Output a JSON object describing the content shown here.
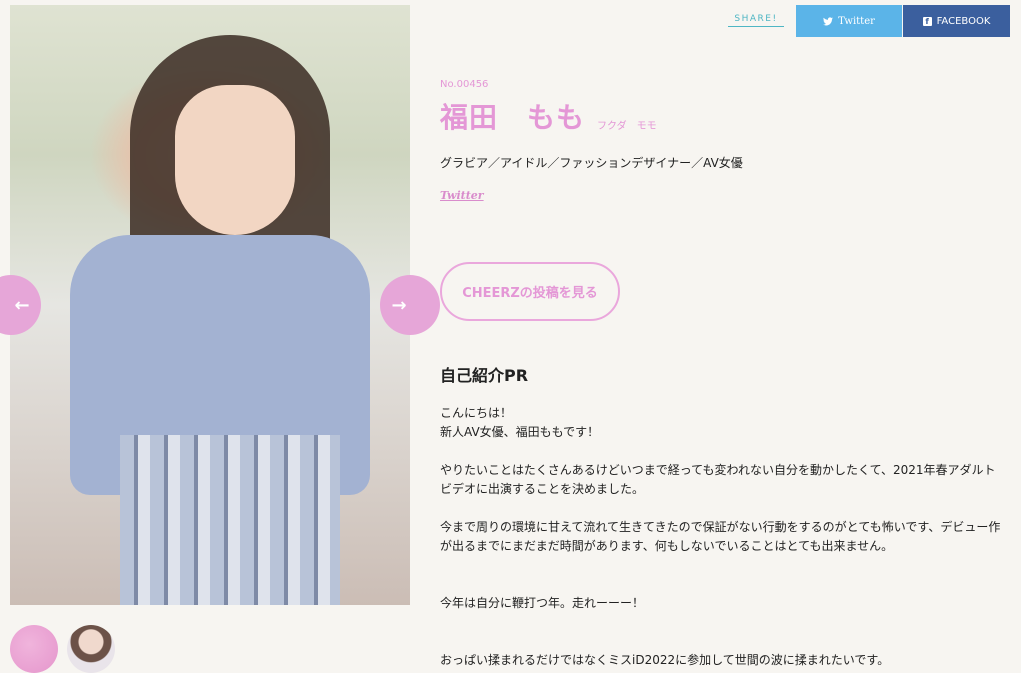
{
  "share": {
    "label": "SHARE!",
    "twitter_label": "Twitter",
    "facebook_label": "FACEBOOK",
    "twitter_color": "#5bb4e8",
    "facebook_color": "#3b5f9e"
  },
  "gallery": {
    "prev_icon": "arrow-left-icon",
    "next_icon": "arrow-right-icon",
    "arrow_color": "#e6a6d8",
    "thumbnail_count": 2
  },
  "profile": {
    "entry_no": "No.00456",
    "name": "福田　もも",
    "kana": "フクダ　モモ",
    "tags": "グラビア／アイドル／ファッションデザイナー／AV女優",
    "twitter_link": "Twitter",
    "accent_color": "#e497d6"
  },
  "cheerz_button": "CHEERZの投稿を見る",
  "pr": {
    "title": "自己紹介PR",
    "lines": [
      "こんにちは！",
      "新人AV女優、福田ももです！",
      "",
      "やりたいことはたくさんあるけどいつまで経っても変われない自分を動かしたくて、2021年春アダルトビデオに出演することを決めました。",
      "",
      "今まで周りの環境に甘えて流れて生きてきたので保証がない行動をするのがとても怖いです、デビュー作が出るまでにまだまだ時間があります、何もしないでいることはとても出来ません。",
      "",
      "",
      "今年は自分に鞭打つ年。走れーーー！",
      "",
      "",
      "おっぱい揉まれるだけではなくミスiD2022に参加して世間の波に揉まれたいです。"
    ]
  }
}
